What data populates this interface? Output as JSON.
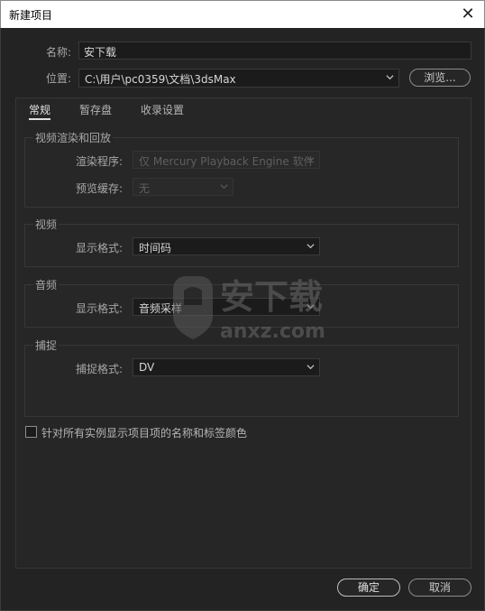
{
  "dialog": {
    "title": "新建项目"
  },
  "name_row": {
    "label": "名称:",
    "value": "安下载"
  },
  "location_row": {
    "label": "位置:",
    "value": "C:\\用户\\pc0359\\文档\\3dsMax",
    "browse_label": "浏览..."
  },
  "tabs": [
    "常规",
    "暂存盘",
    "收录设置"
  ],
  "video_render": {
    "title": "视频渲染和回放",
    "renderer_label": "渲染程序:",
    "renderer_value": "仅 Mercury Playback Engine 软件",
    "preview_cache_label": "预览缓存:",
    "preview_cache_value": "无"
  },
  "video": {
    "title": "视频",
    "display_format_label": "显示格式:",
    "display_format_value": "时间码"
  },
  "audio": {
    "title": "音频",
    "display_format_label": "显示格式:",
    "display_format_value": "音频采样"
  },
  "capture": {
    "title": "捕捉",
    "format_label": "捕捉格式:",
    "format_value": "DV"
  },
  "checkbox": {
    "label": "针对所有实例显示项目项的名称和标签颜色",
    "checked": false
  },
  "buttons": {
    "ok": "确定",
    "cancel": "取消"
  },
  "watermark": {
    "text_cn": "安下载",
    "text_en": "anxz.com"
  }
}
